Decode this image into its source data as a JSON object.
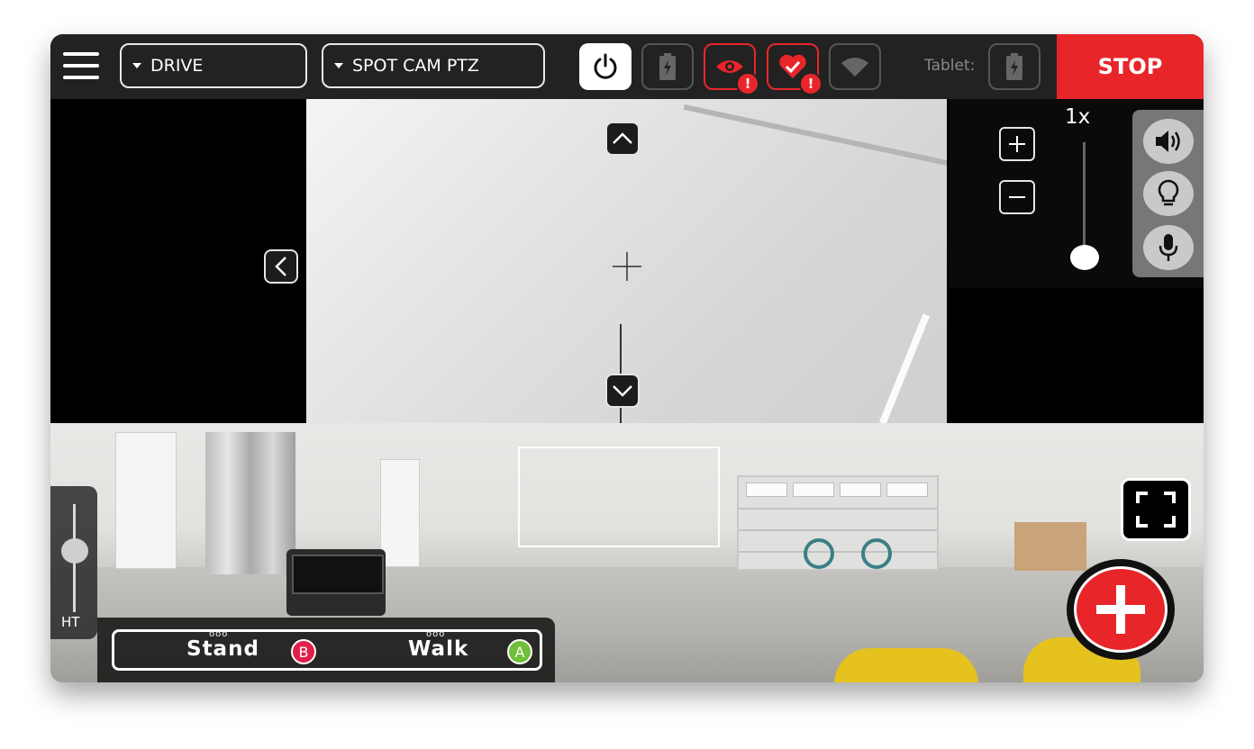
{
  "topbar": {
    "mode_dropdown": "DRIVE",
    "camera_dropdown": "SPOT CAM PTZ",
    "tablet_label": "Tablet:",
    "stop_label": "STOP",
    "status_icons": [
      "power-icon",
      "robot-battery-icon",
      "eye-icon",
      "heart-icon",
      "wifi-icon",
      "tablet-battery-icon"
    ],
    "alert_badge": "!"
  },
  "camera": {
    "zoom_label": "1x",
    "zoom_level": 0.0,
    "zoom_in": "+",
    "zoom_out": "−",
    "tools": [
      "speaker-icon",
      "lightbulb-icon",
      "microphone-icon"
    ]
  },
  "height_control": {
    "label": "HT",
    "level": 0.5
  },
  "gait": {
    "stand_label": "Stand",
    "stand_button": "B",
    "walk_label": "Walk",
    "walk_button": "A",
    "dots": "ooo"
  },
  "colors": {
    "accent_red": "#e8262a",
    "button_b": "#e0204a",
    "button_a": "#6fbf3a",
    "topbar_bg": "#222222"
  }
}
